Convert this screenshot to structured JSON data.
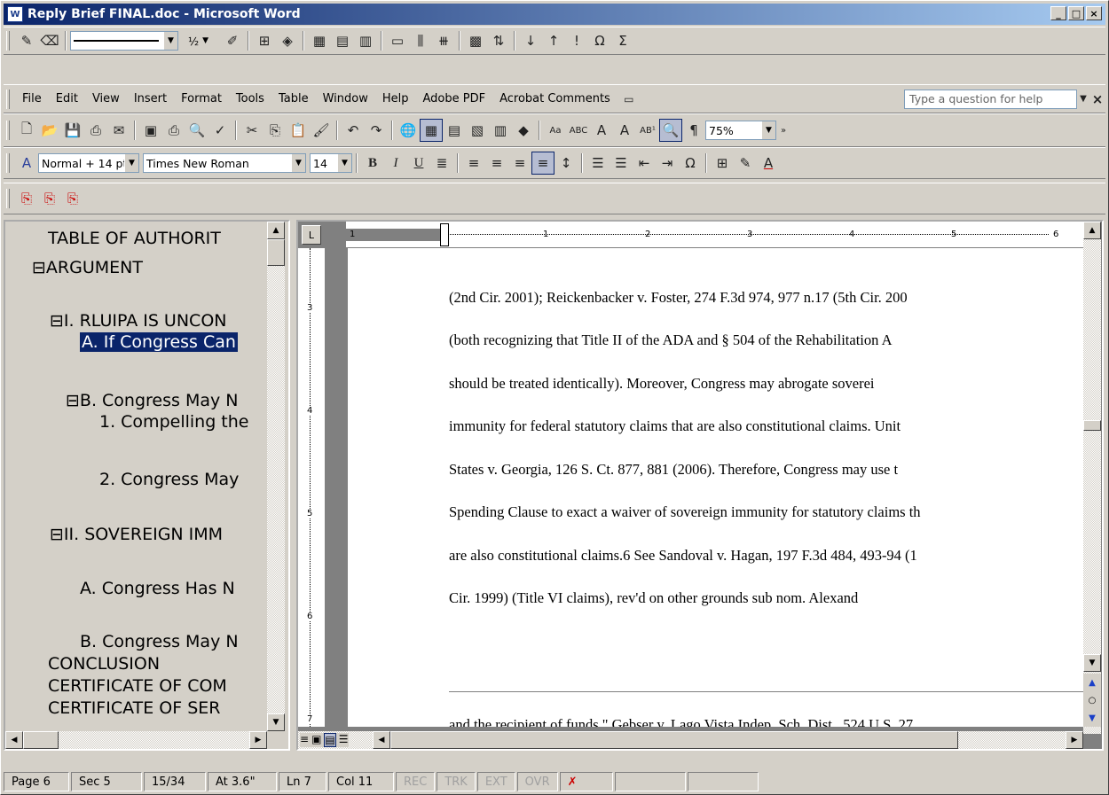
{
  "window": {
    "title": "Reply Brief FINAL.doc - Microsoft Word",
    "app_icon": "word-icon",
    "minimize": "_",
    "maximize": "□",
    "close": "×"
  },
  "drawing_toolbar": {
    "line_weight": "½"
  },
  "menu": {
    "items": [
      "File",
      "Edit",
      "View",
      "Insert",
      "Format",
      "Tools",
      "Table",
      "Window",
      "Help",
      "Adobe PDF",
      "Acrobat Comments"
    ],
    "help_placeholder": "Type a question for help",
    "close_doc": "×"
  },
  "standard_toolbar": {
    "zoom": "75%"
  },
  "formatting_toolbar": {
    "style": "Normal + 14 pt",
    "font": "Times New Roman",
    "size": "14",
    "bold": "B",
    "italic": "I",
    "underline": "U"
  },
  "document_map": {
    "items": [
      {
        "text": "TABLE OF AUTHORIT"
      },
      {
        "text": "⊟ARGUMENT"
      },
      {
        "text": "⊟I. RLUIPA IS UNCON"
      },
      {
        "text": "A. If Congress Can"
      },
      {
        "text": "⊟B. Congress May N"
      },
      {
        "text": "1. Compelling the"
      },
      {
        "text": "2. Congress May"
      },
      {
        "text": "⊟II. SOVEREIGN IMM"
      },
      {
        "text": "A. Congress Has N"
      },
      {
        "text": "B. Congress May N"
      },
      {
        "text": "CONCLUSION"
      },
      {
        "text": "CERTIFICATE OF COM"
      },
      {
        "text": "CERTIFICATE OF SER"
      }
    ]
  },
  "ruler": {
    "h_marks": [
      "1",
      "1",
      "2",
      "3",
      "4",
      "5",
      "6"
    ],
    "v_marks": [
      "3",
      "4",
      "5",
      "6",
      "7"
    ]
  },
  "document": {
    "lines": [
      "(2nd Cir. 2001); Reickenbacker v. Foster, 274 F.3d 974, 977 n.17 (5th Cir. 200",
      "(both recognizing that Title II of the ADA and § 504 of the Rehabilitation A",
      "should be treated identically). Moreover, Congress may abrogate soverei",
      "immunity for federal statutory claims that are also constitutional claims. Unit",
      "States v. Georgia, 126 S. Ct. 877, 881 (2006). Therefore, Congress may use t",
      "Spending Clause to exact a waiver of sovereign immunity for statutory claims th",
      "are also constitutional claims.6  See Sandoval v. Hagan, 197 F.3d 484, 493-94 (1",
      "Cir. 1999) (Title VI claims), rev'd on other grounds sub nom. Alexand"
    ],
    "footnote_line": "and the recipient of funds.\" Gebser v. Lago Vista Indep. Sch. Dist., 524 U.S. 27"
  },
  "status": {
    "page": "Page 6",
    "sec": "Sec 5",
    "pages": "15/34",
    "at": "At 3.6\"",
    "ln": "Ln 7",
    "col": "Col 11",
    "rec": "REC",
    "trk": "TRK",
    "ext": "EXT",
    "ovr": "OVR"
  }
}
